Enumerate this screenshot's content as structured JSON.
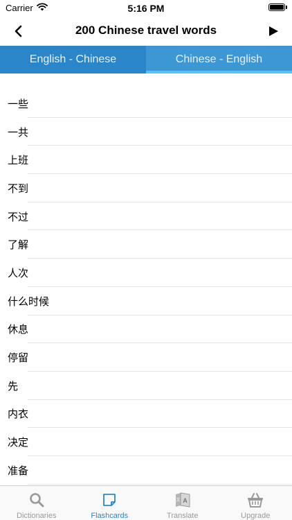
{
  "status_bar": {
    "carrier": "Carrier",
    "time": "5:16 PM"
  },
  "nav": {
    "title": "200 Chinese travel words"
  },
  "tabs": [
    {
      "label": "English - Chinese",
      "active": false
    },
    {
      "label": "Chinese - English",
      "active": true
    }
  ],
  "words": [
    "一些",
    "一共",
    "上班",
    "不到",
    "不过",
    "了解",
    "人次",
    "什么时候",
    "休息",
    "停留",
    "先",
    "内衣",
    "决定",
    "准备"
  ],
  "tab_bar": [
    {
      "label": "Dictionaries",
      "icon": "search-icon",
      "active": false
    },
    {
      "label": "Flashcards",
      "icon": "flashcard-icon",
      "active": true
    },
    {
      "label": "Translate",
      "icon": "translate-icon",
      "active": false
    },
    {
      "label": "Upgrade",
      "icon": "basket-icon",
      "active": false
    }
  ],
  "colors": {
    "accent": "#2a86c8",
    "tab_active_bg": "#3d97d4",
    "tab_indicator": "#5cc0f2",
    "inactive": "#999999"
  }
}
